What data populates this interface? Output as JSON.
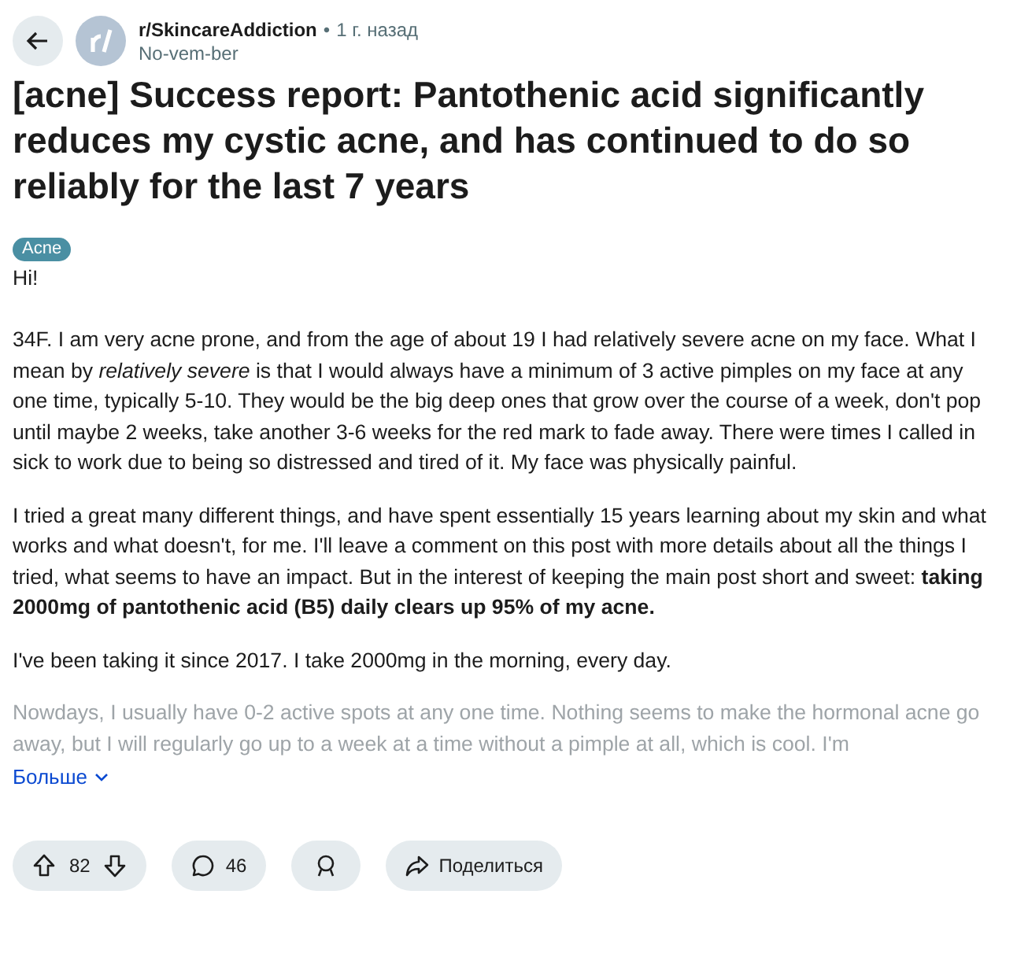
{
  "header": {
    "community": "r/SkincareAddiction",
    "separator": "•",
    "time": "1 г. назад",
    "author": "No-vem-ber"
  },
  "title": "[acne] Success report: Pantothenic acid significantly reduces my cystic acne, and has continued to do so reliably for the last 7 years",
  "flair": {
    "label": "Acne",
    "color": "#4a8fa3"
  },
  "body": [
    {
      "text": "Hi!",
      "faded": false
    },
    {
      "text": "34F. I am very acne prone, and from the age of about 19 I had relatively severe acne on my face. What I mean by *relatively severe* is that I would always have a minimum of 3 active pimples on my face at any one time, typically 5-10. They would be the big deep ones that grow over the course of a week, don't pop until maybe 2 weeks, take another 3-6 weeks for the red mark to fade away. There were times I called in sick to work due to being so distressed and tired of it. My face was physically painful.",
      "faded": false
    },
    {
      "text": "I tried a great many different things, and have spent essentially 15 years learning about my skin and what works and what doesn't, for me. I'll leave a comment on this post with more details about all the things I tried, what seems to have an impact. But in the interest of keeping the main post short and sweet: **taking 2000mg of pantothenic acid (B5) daily clears up 95% of my acne.**",
      "faded": false
    },
    {
      "text": "I've been taking it since 2017. I take 2000mg in the morning, every day.",
      "faded": false
    },
    {
      "text": "Nowdays, I usually have 0-2 active spots at any one time. Nothing seems to make the hormonal acne go away, but I will regularly go up to a week at a time without a pimple at all, which is cool. I'm",
      "faded": true
    }
  ],
  "more": "Больше",
  "actions": {
    "score": "82",
    "comments": "46",
    "share": "Поделиться"
  }
}
